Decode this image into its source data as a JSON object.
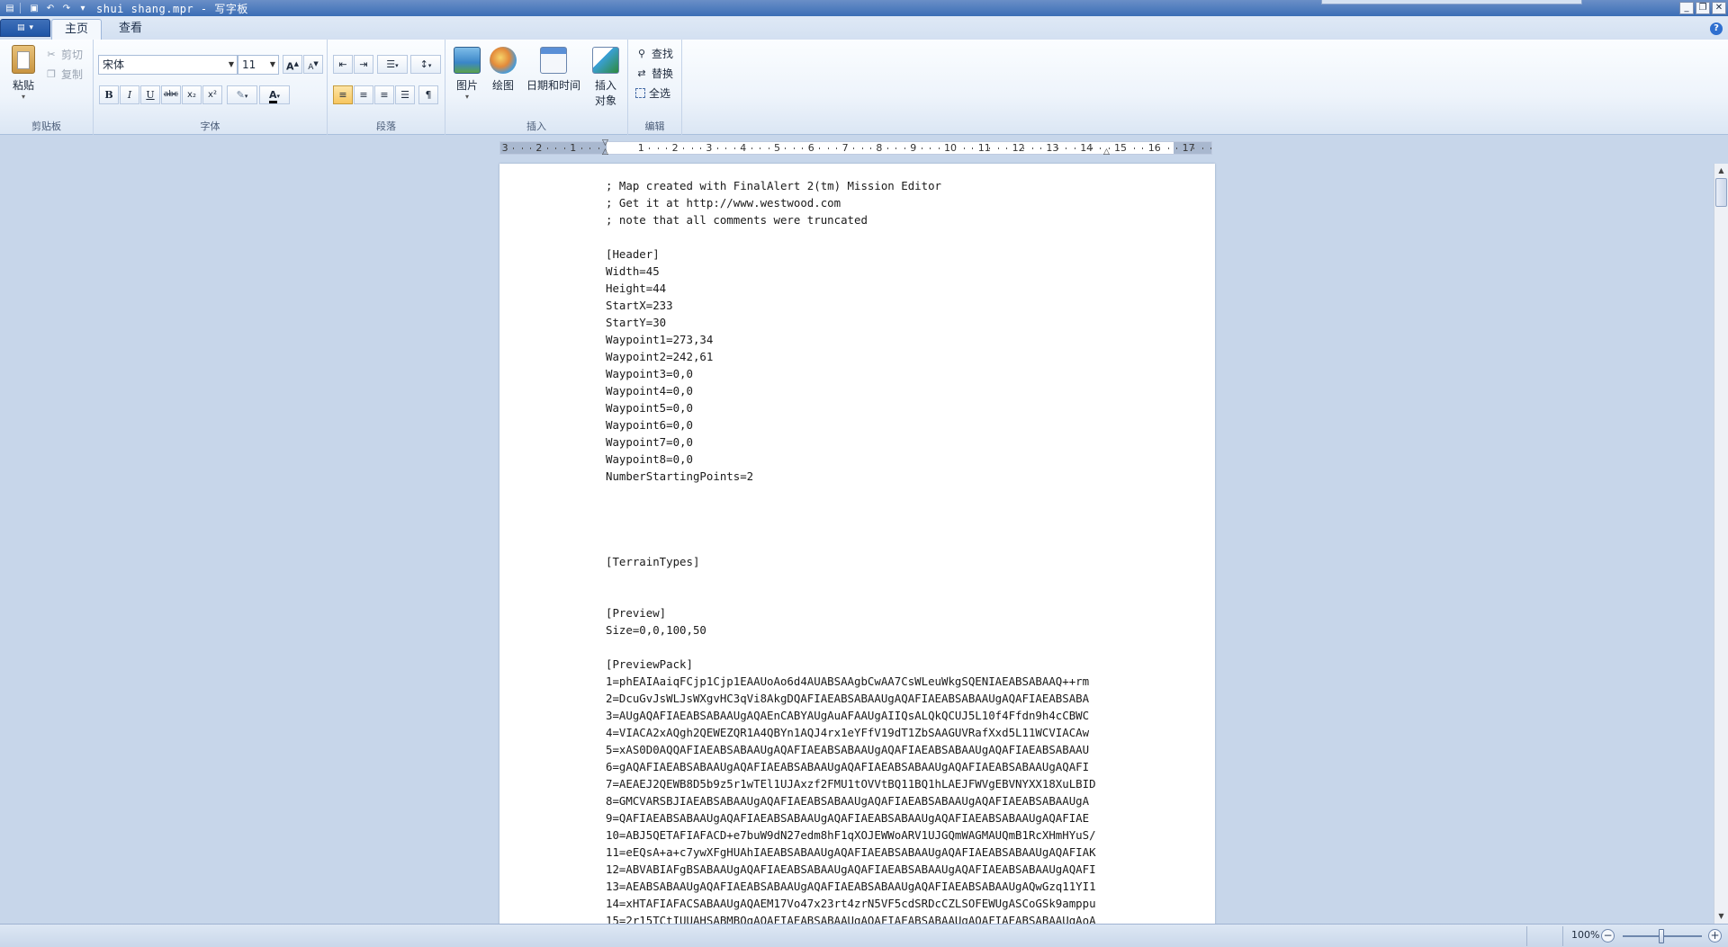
{
  "window": {
    "title": "shui shang.mpr - 写字板",
    "controls": [
      "minimize",
      "restore",
      "close"
    ]
  },
  "tabs": [
    {
      "label": "主页",
      "active": true
    },
    {
      "label": "查看",
      "active": false
    }
  ],
  "ribbon": {
    "clipboard": {
      "label": "剪贴板",
      "paste": "粘贴",
      "cut": "剪切",
      "copy": "复制"
    },
    "font": {
      "label": "字体",
      "family": "宋体",
      "size": "11",
      "bold": "B",
      "italic": "I",
      "underline": "U",
      "strike": "abc",
      "subscript": "x₂",
      "superscript": "x²"
    },
    "paragraph": {
      "label": "段落"
    },
    "insert": {
      "label": "插入",
      "picture": "图片",
      "paint": "绘图",
      "datetime": "日期和时间",
      "object_line1": "插入",
      "object_line2": "对象"
    },
    "editing": {
      "label": "编辑",
      "find": "查找",
      "replace": "替换",
      "select_all": "全选"
    }
  },
  "ruler": {
    "numbers": [
      "3",
      "2",
      "1",
      "1",
      "2",
      "3",
      "4",
      "5",
      "6",
      "7",
      "8",
      "9",
      "10",
      "11",
      "12",
      "13",
      "14",
      "15",
      "16",
      "17"
    ]
  },
  "document": {
    "lines": [
      "; Map created with FinalAlert 2(tm) Mission Editor",
      "; Get it at http://www.westwood.com",
      "; note that all comments were truncated",
      "",
      "[Header]",
      "Width=45",
      "Height=44",
      "StartX=233",
      "StartY=30",
      "Waypoint1=273,34",
      "Waypoint2=242,61",
      "Waypoint3=0,0",
      "Waypoint4=0,0",
      "Waypoint5=0,0",
      "Waypoint6=0,0",
      "Waypoint7=0,0",
      "Waypoint8=0,0",
      "NumberStartingPoints=2",
      "",
      "",
      "",
      "",
      "[TerrainTypes]",
      "",
      "",
      "[Preview]",
      "Size=0,0,100,50",
      "",
      "[PreviewPack]",
      "1=phEAIAaiqFCjp1Cjp1EAAUoAo6d4AUABSAAgbCwAA7CsWLeuWkgSQENIAEABSABAAQ++rm",
      "2=DcuGvJsWLJsWXgvHC3qVi8AkgDQAFIAEABSABAAUgAQAFIAEABSABAAUgAQAFIAEABSABA",
      "3=AUgAQAFIAEABSABAAUgAQAEnCABYAUgAuAFAAUgAIIQsALQkQCUJ5L10f4Ffdn9h4cCBWC",
      "4=VIACA2xAQgh2QEWEZQR1A4QBYn1AQJ4rx1eYFfV19dT1ZbSAAGUVRafXxd5L11WCVIACAw",
      "5=xAS0D0AQQAFIAEABSABAAUgAQAFIAEABSABAAUgAQAFIAEABSABAAUgAQAFIAEABSABAAU",
      "6=gAQAFIAEABSABAAUgAQAFIAEABSABAAUgAQAFIAEABSABAAUgAQAFIAEABSABAAUgAQAFI",
      "7=AEAEJ2QEWB8D5b9z5r1wTEl1UJAxzf2FMU1tOVVtBQ11BQ1hLAEJFWVgEBVNYXX18XuLBID",
      "8=GMCVARSBJIAEABSABAAUgAQAFIAEABSABAAUgAQAFIAEABSABAAUgAQAFIAEABSABAAUgA",
      "9=QAFIAEABSABAAUgAQAFIAEABSABAAUgAQAFIAEABSABAAUgAQAFIAEABSABAAUgAQAFIAE",
      "10=ABJ5QETAFIAFACD+e7buW9dN27edm8hF1qXOJEWWoARV1UJGQmWAGMAUQmB1RcXHmHYuS/",
      "11=eEQsA+a+c7ywXFgHUAhIAEABSABAAUgAQAFIAEABSABAAUgAQAFIAEABSABAAUgAQAFIAK",
      "12=ABVABIAFgBSABAAUgAQAFIAEABSABAAUgAQAFIAEABSABAAUgAQAFIAEABSABAAUgAQAFI",
      "13=AEABSABAAUgAQAFIAEABSABAAUgAQAFIAEABSABAAUgAQAFIAEABSABAAUgAQwGzq11YI1",
      "14=xHTAFIAFACSABAAUgAQAEM17Vo47x23rt4zrN5VF5cdSRDcCZLSOFEWUgASCoGSk9amppu",
      "15=2r15TCtIUUAHSABMBOgAQAFIAEABSABAAUgAQAFIAEABSABAAUgAQAFIAEABSABAAUgAoA"
    ]
  },
  "status": {
    "zoom": "100%",
    "zoom_value": 100
  },
  "colors": {
    "titlebar": "#3b6eb6",
    "ribbon": "#eef4fb",
    "workspace": "#c7d6ea",
    "active_button": "#f7c65f"
  }
}
